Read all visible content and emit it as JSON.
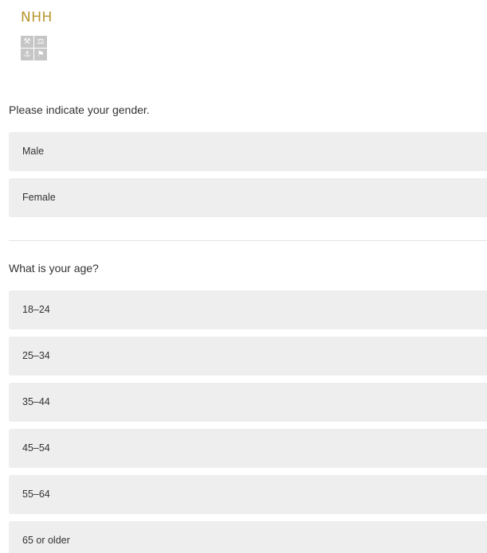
{
  "header": {
    "brand_name": "NHH",
    "emblem": {
      "quadrants": [
        "⚒",
        "⚖",
        "⚓",
        "⚑"
      ],
      "color": "#c6c6c6"
    },
    "brand_color": "#b8962e"
  },
  "gender_question": {
    "text": "Please indicate your gender.",
    "options": [
      "Male",
      "Female"
    ]
  },
  "age_question": {
    "text": "What is your age?",
    "options": [
      "18–24",
      "25–34",
      "35–44",
      "45–54",
      "55–64",
      "65 or older"
    ]
  },
  "colors": {
    "option_background": "#eeeeee",
    "text": "#333333",
    "divider": "#e4e4e4"
  }
}
